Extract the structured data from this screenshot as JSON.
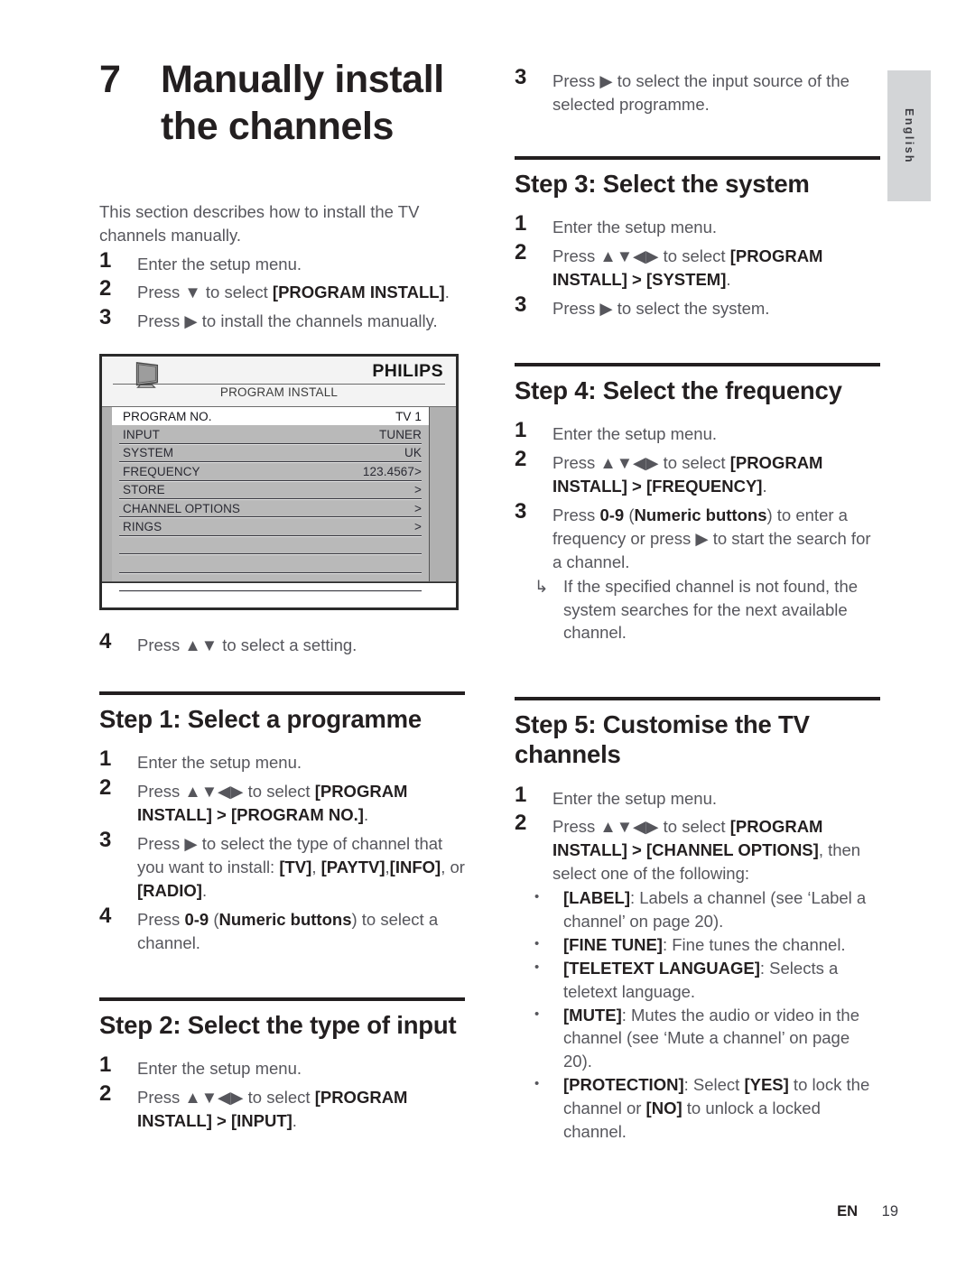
{
  "page": {
    "language_tab": "English",
    "footer_lang": "EN",
    "footer_page": "19"
  },
  "chapter": {
    "number": "7",
    "title": "Manually install the channels",
    "intro": "This section describes how to install the TV channels manually."
  },
  "intro_steps": [
    {
      "num": "1",
      "text_html": "Enter the setup menu."
    },
    {
      "num": "2",
      "text_html": "Press ▼ to select <b>[PROGRAM INSTALL]</b>."
    },
    {
      "num": "3",
      "text_html": "Press ▶ to install the channels manually."
    }
  ],
  "after_osd_steps": [
    {
      "num": "4",
      "text_html": "Press ▲▼ to select a setting."
    }
  ],
  "osd": {
    "brand": "PHILIPS",
    "title": "PROGRAM INSTALL",
    "tv_icon": "tv-icon",
    "rows": [
      {
        "label": "PROGRAM NO.",
        "value": "TV 1",
        "selected": true
      },
      {
        "label": "INPUT",
        "value": "TUNER",
        "selected": false
      },
      {
        "label": "SYSTEM",
        "value": "UK",
        "selected": false
      },
      {
        "label": "FREQUENCY",
        "value": "123.4567>",
        "selected": false
      },
      {
        "label": "STORE",
        "value": ">",
        "selected": false
      },
      {
        "label": "CHANNEL OPTIONS",
        "value": ">",
        "selected": false
      },
      {
        "label": "RINGS",
        "value": ">",
        "selected": false
      },
      {
        "label": "",
        "value": "",
        "selected": false
      },
      {
        "label": "",
        "value": "",
        "selected": false
      },
      {
        "label": "",
        "value": "",
        "selected": false
      }
    ]
  },
  "sections": {
    "step1": {
      "title": "Step 1: Select a programme",
      "steps": [
        {
          "num": "1",
          "text_html": "Enter the setup menu."
        },
        {
          "num": "2",
          "text_html": "Press ▲▼◀▶ to select <b>[PROGRAM INSTALL] &gt; [PROGRAM NO.]</b>."
        },
        {
          "num": "3",
          "text_html": "Press ▶ to select the type of channel that you want to install: <b>[TV]</b>, <b>[PAYTV]</b>,<b>[INFO]</b>, or <b>[RADIO]</b>."
        },
        {
          "num": "4",
          "text_html": "Press <b>0-9</b> (<b>Numeric buttons</b>) to select a channel."
        }
      ]
    },
    "step2": {
      "title": "Step 2: Select the type of input",
      "steps": [
        {
          "num": "1",
          "text_html": "Enter the setup menu."
        },
        {
          "num": "2",
          "text_html": "Press ▲▼◀▶ to select <b>[PROGRAM INSTALL] &gt; [INPUT]</b>."
        }
      ]
    },
    "step2_cont": {
      "steps": [
        {
          "num": "3",
          "text_html": "Press ▶ to select the input source of the selected programme."
        }
      ]
    },
    "step3": {
      "title": "Step 3: Select the system",
      "steps": [
        {
          "num": "1",
          "text_html": "Enter the setup menu."
        },
        {
          "num": "2",
          "text_html": "Press ▲▼◀▶ to select <b>[PROGRAM INSTALL] &gt; [SYSTEM]</b>."
        },
        {
          "num": "3",
          "text_html": "Press ▶ to select the system."
        }
      ]
    },
    "step4": {
      "title": "Step 4: Select the frequency",
      "steps": [
        {
          "num": "1",
          "text_html": "Enter the setup menu."
        },
        {
          "num": "2",
          "text_html": "Press ▲▼◀▶ to select <b>[PROGRAM INSTALL] &gt; [FREQUENCY]</b>."
        },
        {
          "num": "3",
          "text_html": "Press <b>0-9</b> (<b>Numeric buttons</b>) to enter a frequency or press ▶ to start the search for a channel."
        }
      ],
      "note": {
        "marker": "↳",
        "text_html": "If the specified channel is not found, the system searches for the next available channel."
      }
    },
    "step5": {
      "title": "Step 5: Customise the TV channels",
      "steps": [
        {
          "num": "1",
          "text_html": "Enter the setup menu."
        },
        {
          "num": "2",
          "text_html": "Press ▲▼◀▶ to select <b>[PROGRAM INSTALL] &gt; [CHANNEL OPTIONS]</b>, then select one of the following:"
        }
      ],
      "bullets": [
        {
          "marker": "•",
          "text_html": "<b>[LABEL]</b>: Labels a channel (see ‘Label a channel’ on page 20)."
        },
        {
          "marker": "•",
          "text_html": "<b>[FINE TUNE]</b>: Fine tunes the channel."
        },
        {
          "marker": "•",
          "text_html": "<b>[TELETEXT LANGUAGE]</b>: Selects a teletext language."
        },
        {
          "marker": "•",
          "text_html": "<b>[MUTE]</b>: Mutes the audio or video in the channel (see ‘Mute a channel’ on page 20)."
        },
        {
          "marker": "•",
          "text_html": "<b>[PROTECTION]</b>: Select <b>[YES]</b> to lock the channel or <b>[NO]</b> to unlock a locked channel."
        }
      ]
    }
  }
}
